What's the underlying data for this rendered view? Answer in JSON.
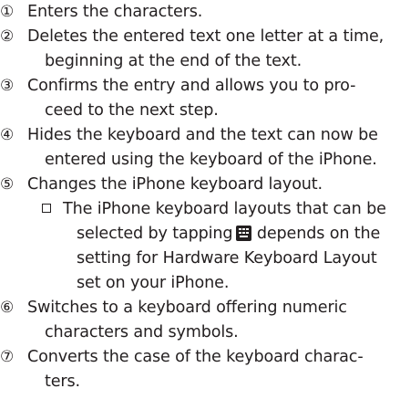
{
  "items": [
    {
      "marker": "①",
      "lines": [
        "Enters the characters."
      ]
    },
    {
      "marker": "②",
      "lines": [
        "Deletes the entered text one letter at a time,",
        "beginning at the end of the text."
      ]
    },
    {
      "marker": "③",
      "lines": [
        "Confirms the entry and allows you to pro-",
        "ceed to the next step."
      ]
    },
    {
      "marker": "④",
      "lines": [
        "Hides the keyboard and the text can now be",
        "entered using the keyboard of the iPhone."
      ]
    },
    {
      "marker": "⑤",
      "lines": [
        "Changes the iPhone keyboard layout."
      ]
    },
    {
      "marker": "⑥",
      "lines": [
        "Switches to a keyboard offering numeric",
        "characters and symbols."
      ]
    },
    {
      "marker": "⑦",
      "lines": [
        "Converts the case of the keyboard charac-",
        "ters."
      ]
    }
  ],
  "note": {
    "line1": "The iPhone keyboard layouts that can be",
    "line2_before": "selected by tapping",
    "line2_icon": "keyboard-layout-icon",
    "line2_after": " depends on the",
    "line3": "setting for Hardware Keyboard Layout",
    "line4": "set on your iPhone."
  }
}
